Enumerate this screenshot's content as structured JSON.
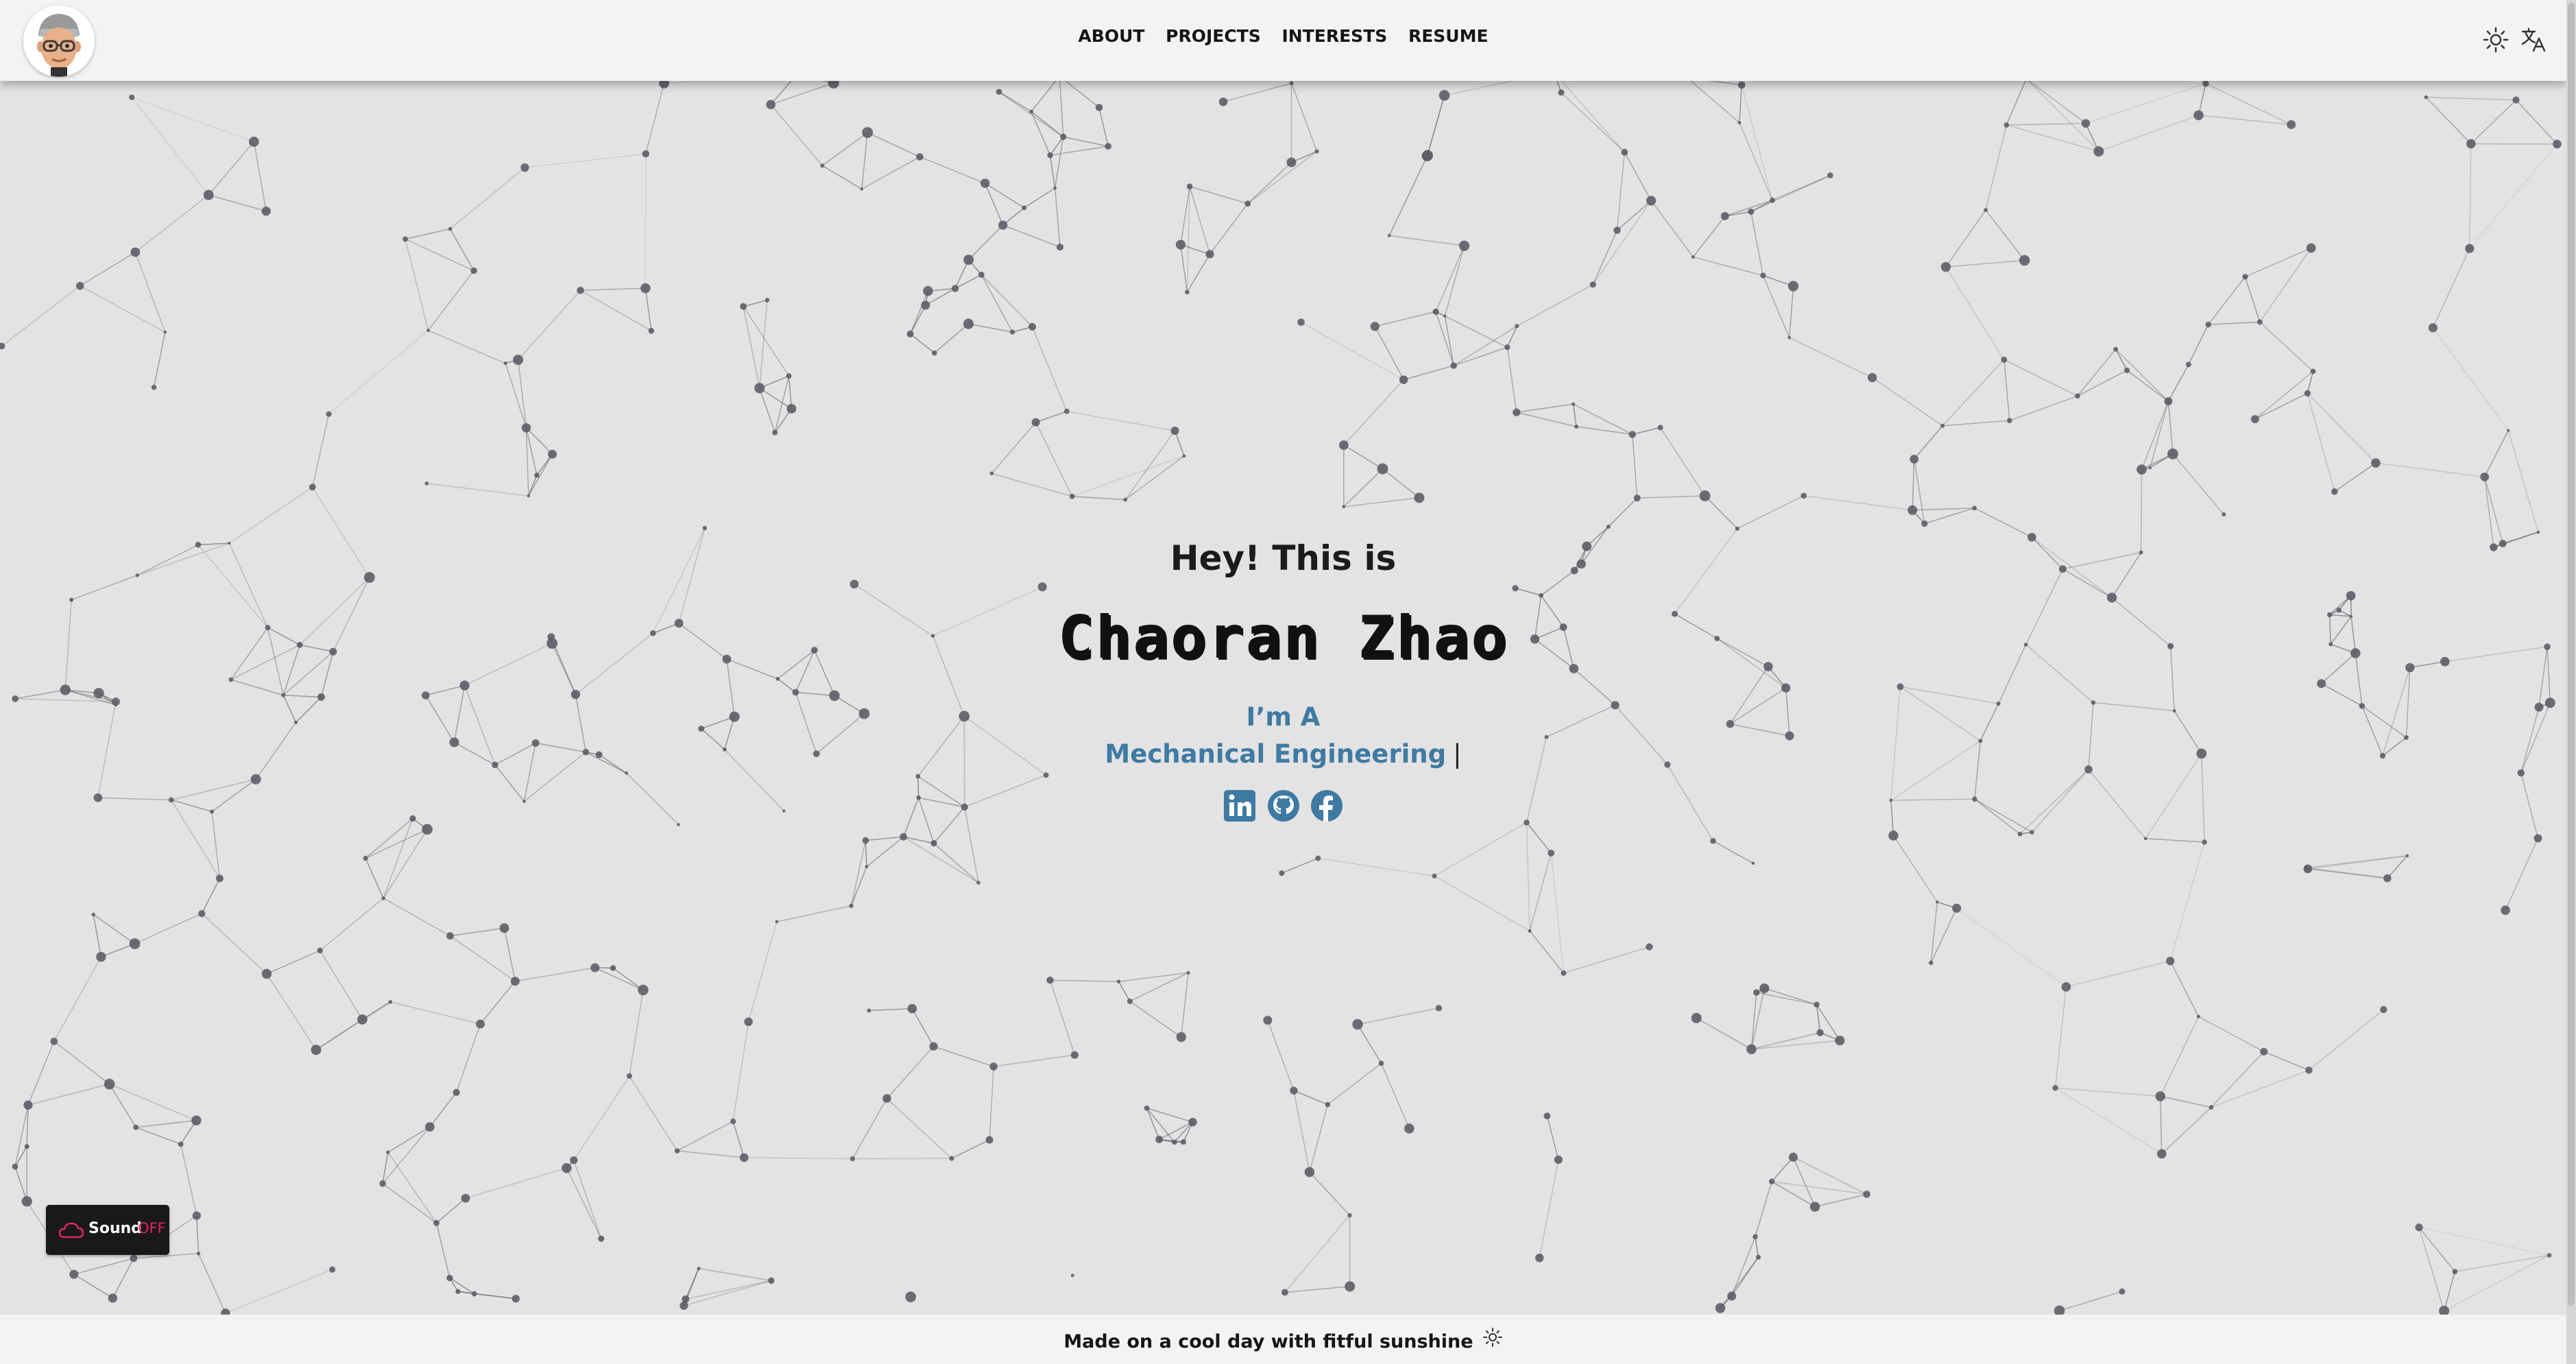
{
  "nav": {
    "items": [
      "ABOUT",
      "PROJECTS",
      "INTERESTS",
      "RESUME"
    ]
  },
  "header": {
    "avatar": "memoji-avatar",
    "theme_icon": "sun-icon",
    "language_icon": "translate-icon"
  },
  "hero": {
    "greeting": "Hey! This is",
    "name": "Chaoran Zhao",
    "intro": "I’m A",
    "role": "Mechanical Engineering",
    "caret": "|",
    "socials": [
      "linkedin-icon",
      "github-icon",
      "facebook-icon"
    ]
  },
  "sound_toggle": {
    "label": "Sound",
    "state": "OFF",
    "icon": "cloud-icon"
  },
  "footer": {
    "text": "Made on a cool day with fitful sunshine",
    "icon": "sun-icon"
  },
  "colors": {
    "accent": "#3f7aa3",
    "sound_off": "#e0245e",
    "background": "#e3e3e3",
    "network": "#5d5d66"
  }
}
